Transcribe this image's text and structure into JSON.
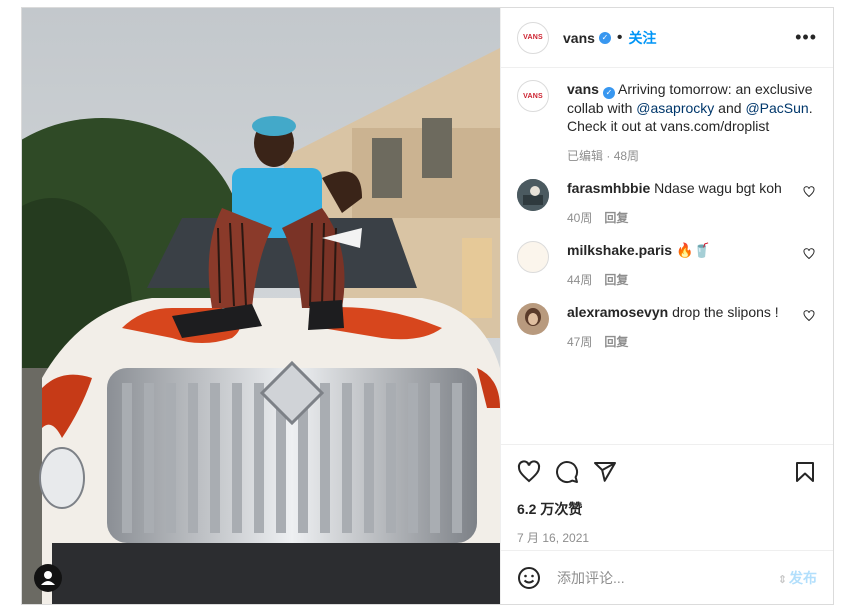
{
  "post": {
    "username": "vans",
    "avatar_text": "VANS",
    "follow_label": "关注",
    "header_separator": "•",
    "more_label": "•••"
  },
  "caption": {
    "username": "vans",
    "text_1": "Arriving tomorrow: an exclusive collab with ",
    "mention_1": "@asaprocky",
    "text_2": " and ",
    "mention_2": "@PacSun",
    "text_3": ". Check it out at vans.com/droplist",
    "edited": "已编辑",
    "time": "48周"
  },
  "comments": [
    {
      "username": "farasmhbbie",
      "text": "Ndase wagu bgt koh",
      "time": "40周",
      "reply": "回复"
    },
    {
      "username": "milkshake.paris",
      "text": "🔥🥤",
      "time": "44周",
      "reply": "回复"
    },
    {
      "username": "alexramosevyn",
      "text": "drop the slipons !",
      "time": "47周",
      "reply": "回复"
    }
  ],
  "actions": {
    "likes": "6.2 万次赞",
    "date": "7 月 16, 2021"
  },
  "composer": {
    "placeholder": "添加评论...",
    "post_label": "发布",
    "post_arrows": "⇕"
  },
  "icons": {
    "like": "heart-icon",
    "comment": "comment-icon",
    "share": "share-icon",
    "save": "bookmark-icon",
    "emoji": "emoji-icon",
    "verified": "verified-badge-icon",
    "user_tag": "user-tag-icon"
  },
  "colors": {
    "link": "#00376b",
    "follow": "#0095f6",
    "verified": "#3897f0",
    "post_button": "#b2dffc",
    "muted": "#8e8e8e"
  }
}
